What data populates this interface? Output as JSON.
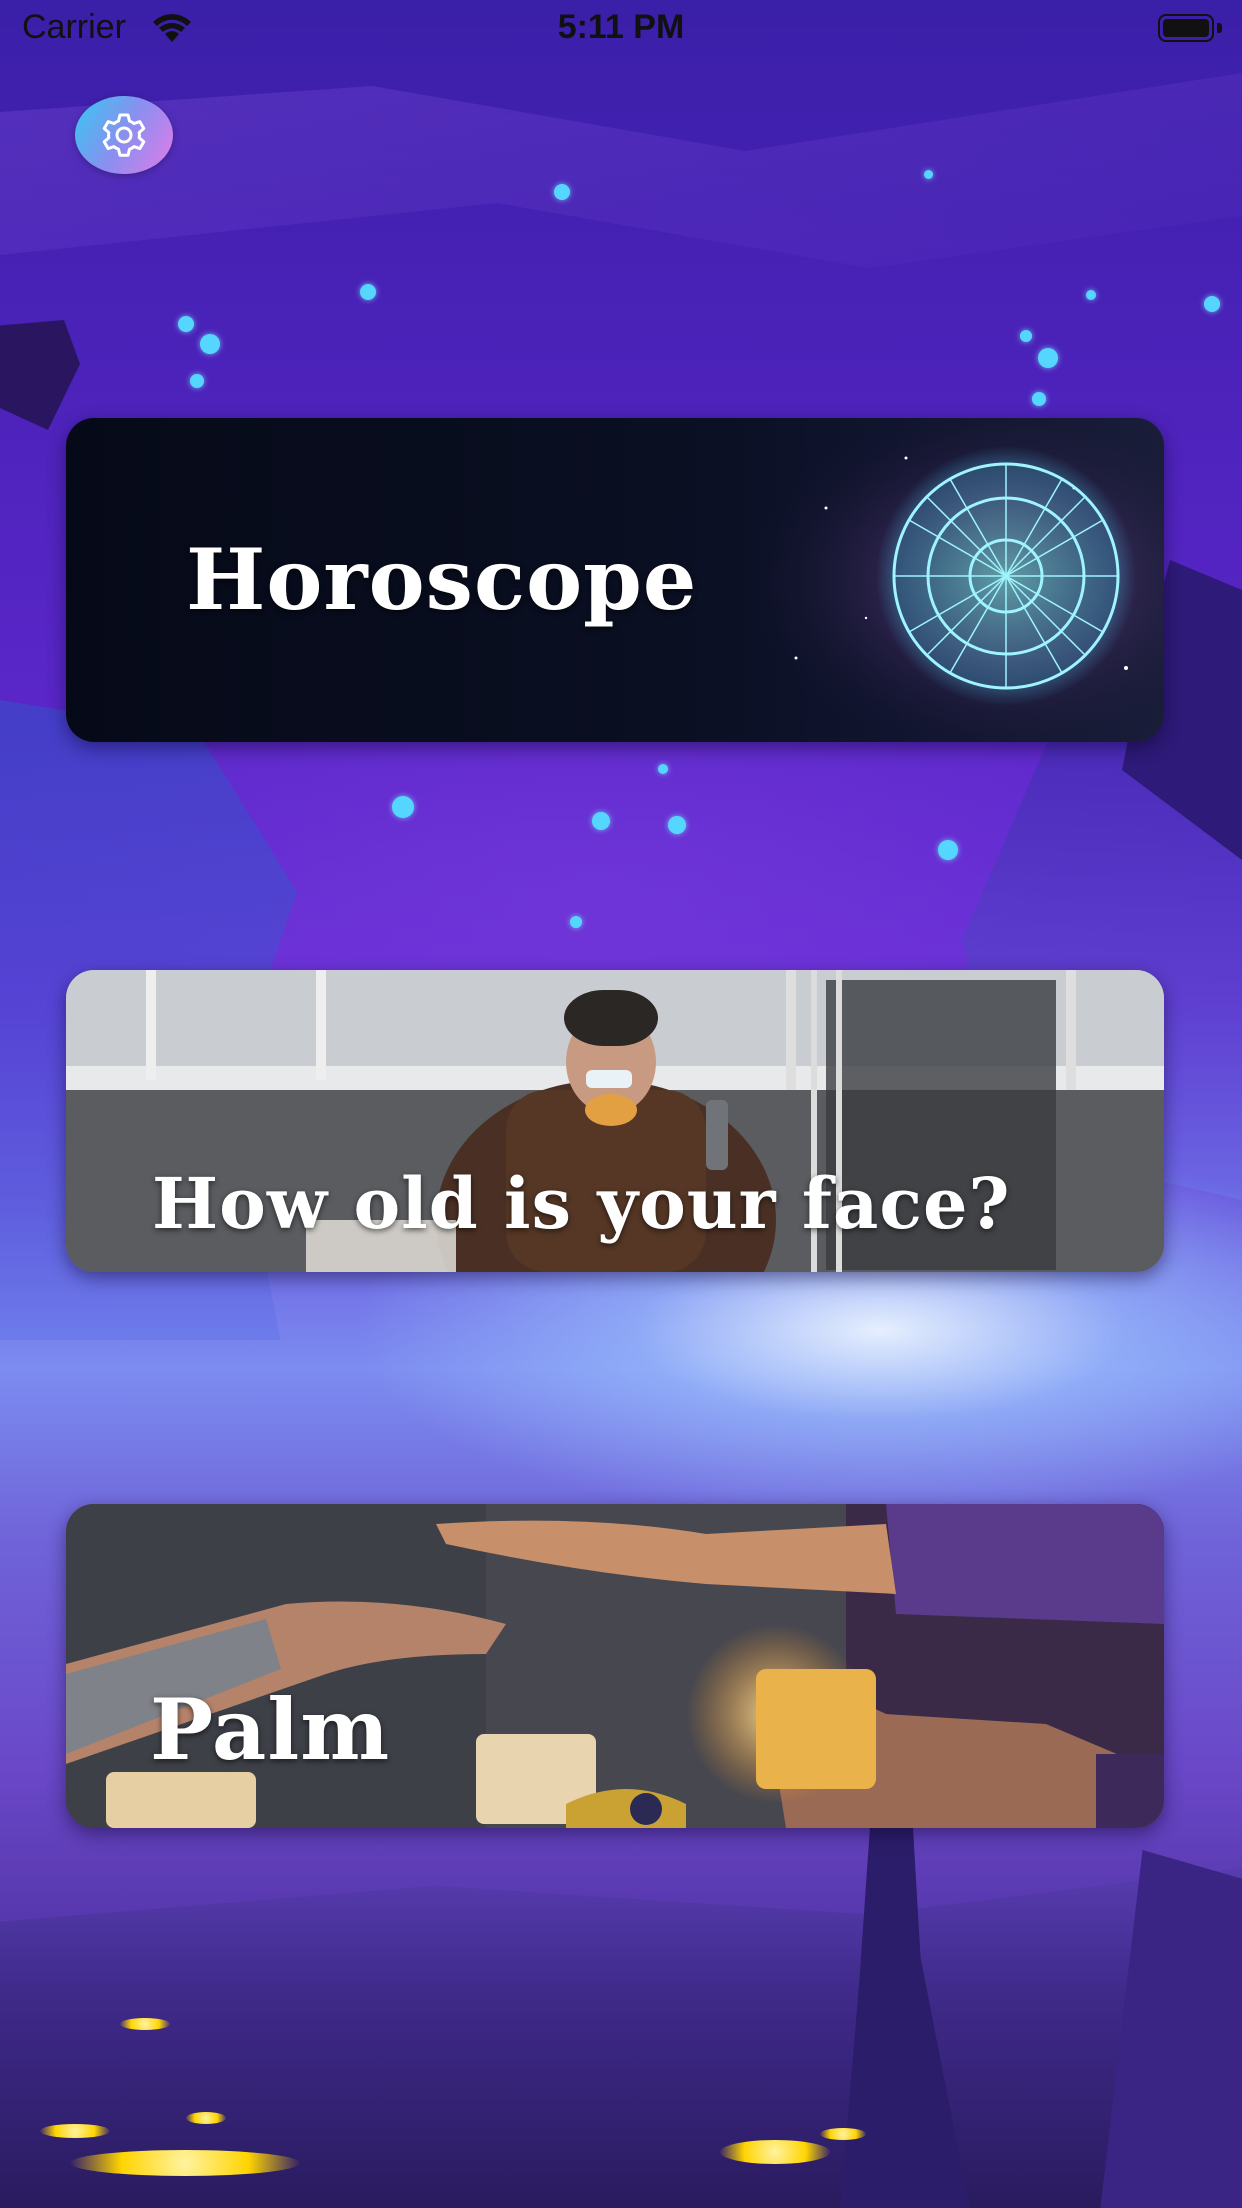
{
  "status_bar": {
    "carrier": "Carrier",
    "time": "5:11 PM"
  },
  "settings": {
    "icon": "gear-icon"
  },
  "cards": [
    {
      "title": "Horoscope",
      "image": "zodiac-wheel-image"
    },
    {
      "title": "How old is your face?",
      "image": "elderly-man-photo"
    },
    {
      "title": "Palm",
      "image": "palm-reading-hands-photo"
    }
  ]
}
